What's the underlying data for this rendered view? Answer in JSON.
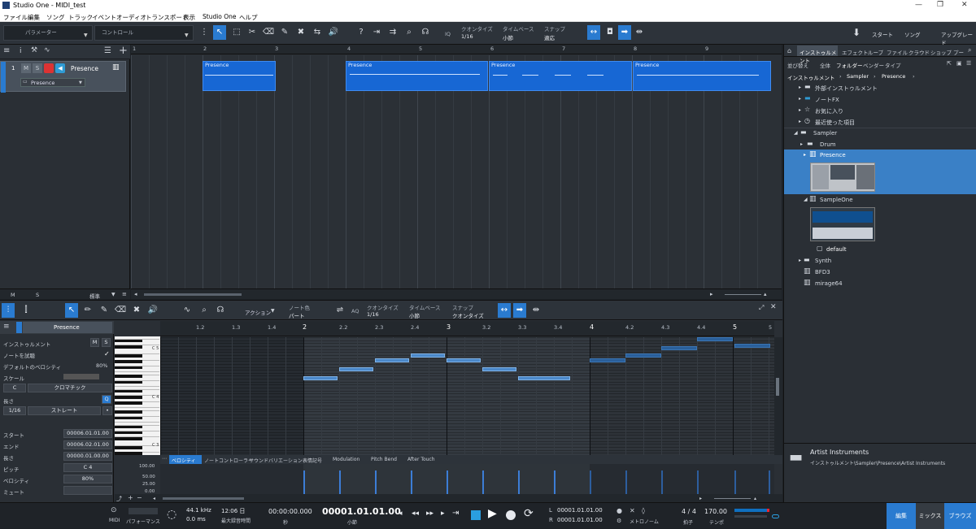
{
  "window": {
    "title": "Studio One - MIDI_test"
  },
  "menu": [
    "ファイル",
    "編集",
    "ソング",
    "トラック",
    "イベント",
    "オーディオ",
    "トランスポート",
    "表示",
    "Studio One",
    "ヘルプ"
  ],
  "toolbar": {
    "param_label": "パラメーター",
    "control_label": "コントロール",
    "quantize_label": "クオンタイズ",
    "quantize_value": "1/16",
    "timebase_label": "タイムベース",
    "timebase_value": "小節",
    "snap_label": "スナップ",
    "snap_value": "適応",
    "iq_label": "IQ",
    "start_label": "スタート",
    "song_label": "ソング",
    "upgrade_label": "アップグレード"
  },
  "track": {
    "number": "1",
    "m": "M",
    "s": "S",
    "name": "Presence",
    "instrument": "Presence"
  },
  "track_footer": {
    "m": "M",
    "s": "S",
    "std": "標準"
  },
  "arrange": {
    "ruler": [
      "1",
      "2",
      "3",
      "4",
      "5",
      "6",
      "7",
      "8",
      "9"
    ],
    "clips": [
      "Presence",
      "Presence",
      "Presence",
      "Presence"
    ]
  },
  "browser": {
    "tabs": [
      "インストゥルメント",
      "エフェクト",
      "ループ",
      "ファイル",
      "クラウド",
      "ショップ",
      "プー"
    ],
    "sort_label": "並び替え",
    "filters": [
      "全体",
      "フォルダー",
      "ベンダー",
      "タイプ"
    ],
    "path": [
      "インストゥルメント",
      "Sampler",
      "Presence"
    ],
    "items": {
      "external": "外部インストゥルメント",
      "notefx": "ノートFX",
      "favorites": "お気に入り",
      "recent": "最近使った項目",
      "sampler": "Sampler",
      "drum": "Drum",
      "presence": "Presence",
      "sampleone": "SampleOne",
      "default": "default",
      "synth": "Synth",
      "bfd3": "BFD3",
      "mirage": "mirage64"
    },
    "footer_title": "Artist Instruments",
    "footer_path": "インストゥルメント\\Sampler\\Presence\\Artist Instruments"
  },
  "editor": {
    "toolbar": {
      "action_label": "アクション",
      "notecolor_label": "ノート色",
      "notecolor_value": "パート",
      "aq_label": "AQ",
      "quantize_label": "クオンタイズ",
      "quantize_value": "1/16",
      "timebase_label": "タイムベース",
      "timebase_value": "小節",
      "snap_label": "スナップ",
      "snap_value": "クオンタイズ"
    },
    "instrument_name": "Presence",
    "inspector": {
      "instrument_label": "インストゥルメント",
      "m": "M",
      "s": "S",
      "audition_label": "ノートを試聴",
      "default_vel_label": "デフォルトのベロシティ",
      "default_vel_value": "80%",
      "scale_label": "スケール",
      "scale_key": "C",
      "scale_type": "クロマチック",
      "length_label": "長さ",
      "q_label": "Q",
      "length_value": "1/16",
      "length_mode": "ストレート",
      "start_label": "スタート",
      "start_value": "00006.01.01.00",
      "end_label": "エンド",
      "end_value": "00006.02.01.00",
      "len2_label": "長さ",
      "len2_value": "00000.01.00.00",
      "pitch_label": "ピッチ",
      "pitch_value": "C 4",
      "velocity_label": "ベロシティ",
      "velocity_value": "80%",
      "mute_label": "ミュート"
    },
    "piano_labels": [
      "C 5",
      "C 4",
      "C 3"
    ],
    "ruler": [
      "1.2",
      "1.3",
      "1.4",
      "2",
      "2.2",
      "2.3",
      "2.4",
      "3",
      "3.2",
      "3.3",
      "3.4",
      "4",
      "4.2",
      "4.3",
      "4.4",
      "5",
      "5"
    ],
    "lane_tabs": [
      "ベロシティ",
      "ノートコントローラー",
      "サウンドバリエーション",
      "表情記号",
      "Modulation",
      "Pitch Bend",
      "After Touch"
    ],
    "vel_scale": [
      "100.00",
      "50.00",
      "25.00",
      "0.00"
    ]
  },
  "transport": {
    "midi_label": "MIDI",
    "perf_label": "パフォーマンス",
    "rate": "44.1 kHz",
    "latency": "0.0 ms",
    "time": "12:06 日",
    "rec_max": "最大録音時間",
    "seconds": "00:00:00.000",
    "seconds_label": "秒",
    "position": "00001.01.01.00",
    "position_label": "小節",
    "left": "00001.01.01.00",
    "right": "00001.01.01.00",
    "l_label": "L",
    "r_label": "R",
    "metronome_label": "メトロノーム",
    "signature": "4 / 4",
    "signature_label": "拍子",
    "tempo": "170.00",
    "tempo_label": "テンポ",
    "edit_btn": "編集",
    "mix_btn": "ミックス",
    "browse_btn": "ブラウズ"
  },
  "colors": {
    "accent": "#2a7bd0",
    "clip": "#1767d4",
    "note": "#4b88c9"
  }
}
